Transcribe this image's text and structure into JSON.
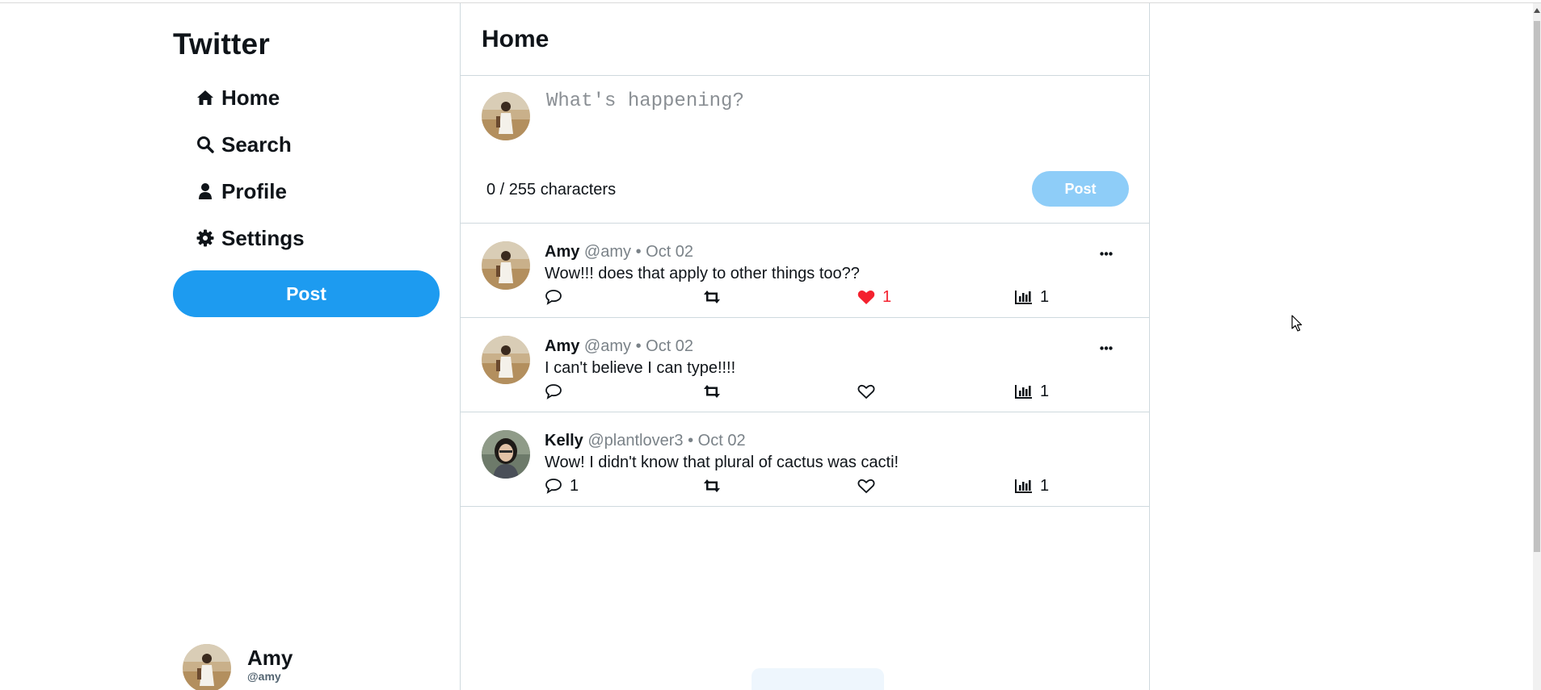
{
  "sidebar": {
    "brand": "Twitter",
    "nav": [
      {
        "label": "Home",
        "icon": "home-icon"
      },
      {
        "label": "Search",
        "icon": "search-icon"
      },
      {
        "label": "Profile",
        "icon": "user-icon"
      },
      {
        "label": "Settings",
        "icon": "gear-icon"
      }
    ],
    "post_label": "Post",
    "account": {
      "name": "Amy",
      "handle": "@amy"
    }
  },
  "main": {
    "title": "Home",
    "composer": {
      "placeholder": "What's happening?",
      "char_count": "0 / 255 characters",
      "post_label": "Post"
    },
    "tweets": [
      {
        "name": "Amy",
        "handle": "@amy",
        "date": "• Oct 02",
        "text": "Wow!!! does that apply to other things too??",
        "replies": "",
        "liked": true,
        "likes": "1",
        "views": "1",
        "has_menu": true
      },
      {
        "name": "Amy",
        "handle": "@amy",
        "date": "• Oct 02",
        "text": "I can't believe I can type!!!!",
        "replies": "",
        "liked": false,
        "likes": "",
        "views": "1",
        "has_menu": true
      },
      {
        "name": "Kelly",
        "handle": "@plantlover3",
        "date": "• Oct 02",
        "text": "Wow! I didn't know that plural of cactus was cacti!",
        "replies": "1",
        "liked": false,
        "likes": "",
        "views": "1",
        "has_menu": false
      }
    ]
  },
  "colors": {
    "accent": "#1d9bf0",
    "accent_disabled": "#8ecdf8",
    "like": "#f4212e",
    "border": "#cfd9de"
  }
}
